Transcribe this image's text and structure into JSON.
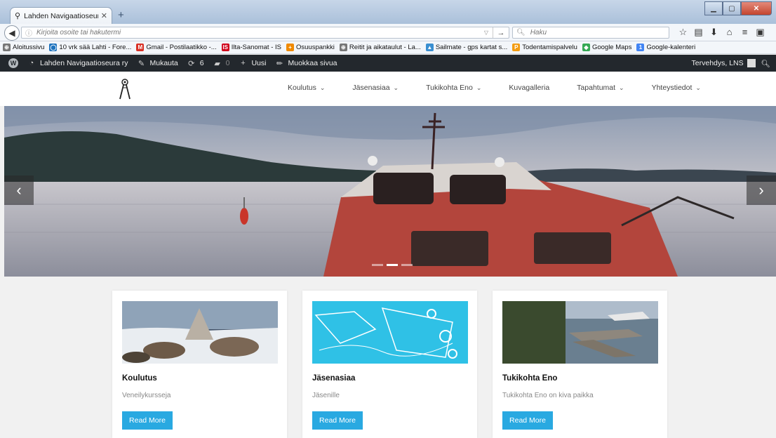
{
  "browser": {
    "tab_title": "Lahden Navigaatioseura ry ...",
    "new_tab_label": "+",
    "url_placeholder": "Kirjoita osoite tai hakutermi",
    "search_placeholder": "Haku"
  },
  "bookmarks": [
    {
      "label": "Aloitussivu",
      "icon": "globe-icon",
      "color": "#777777",
      "glyph": "⊕"
    },
    {
      "label": "10 vrk sää Lahti - Fore...",
      "icon": "foreca-icon",
      "color": "#1e73be",
      "glyph": "◯"
    },
    {
      "label": "Gmail - Postilaatikko -...",
      "icon": "gmail-icon",
      "color": "#d93025",
      "glyph": "M"
    },
    {
      "label": "Ilta-Sanomat - IS",
      "icon": "is-icon",
      "color": "#d0021b",
      "glyph": "IS"
    },
    {
      "label": "Osuuspankki",
      "icon": "op-icon",
      "color": "#f08a00",
      "glyph": "+"
    },
    {
      "label": "Reitit ja aikataulut - La...",
      "icon": "globe-icon",
      "color": "#777777",
      "glyph": "⊕"
    },
    {
      "label": "Sailmate - gps kartat s...",
      "icon": "sailmate-icon",
      "color": "#3a8fd1",
      "glyph": "▲"
    },
    {
      "label": "Todentamispalvelu",
      "icon": "p-icon",
      "color": "#f39c12",
      "glyph": "P"
    },
    {
      "label": "Google Maps",
      "icon": "maps-icon",
      "color": "#34a853",
      "glyph": "◆"
    },
    {
      "label": "Google-kalenteri",
      "icon": "calendar-icon",
      "color": "#4285f4",
      "glyph": "1"
    }
  ],
  "wpbar": {
    "site": "Lahden Navigaatioseura ry",
    "customize": "Mukauta",
    "updates": "6",
    "comments": "0",
    "new": "Uusi",
    "edit": "Muokkaa sivua",
    "greeting": "Tervehdys, LNS"
  },
  "menu": [
    {
      "label": "Koulutus",
      "dropdown": true
    },
    {
      "label": "Jäsenasiaa",
      "dropdown": true
    },
    {
      "label": "Tukikohta Eno",
      "dropdown": true
    },
    {
      "label": "Kuvagalleria",
      "dropdown": false
    },
    {
      "label": "Tapahtumat",
      "dropdown": true
    },
    {
      "label": "Yhteystiedot",
      "dropdown": true
    }
  ],
  "slider": {
    "prev": "‹",
    "next": "›",
    "slide_count": 3,
    "active_slide": 1
  },
  "cards": [
    {
      "title": "Koulutus",
      "subtitle": "Veneilykursseja",
      "button": "Read More"
    },
    {
      "title": "Jäsenasiaa",
      "subtitle": "Jäsenille",
      "button": "Read More"
    },
    {
      "title": "Tukikohta Eno",
      "subtitle": "Tukikohta Eno on kiva paikka",
      "button": "Read More"
    }
  ],
  "colors": {
    "accent": "#29a9e1",
    "adminbar": "#23282d",
    "background": "#f1f1f1"
  }
}
